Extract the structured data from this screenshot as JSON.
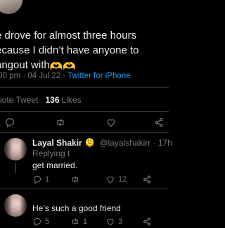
{
  "tweet": {
    "text": "e drove for almost three hours\necause I didn’t have anyone to\nangout with",
    "emoji": "🫶🫶",
    "time_date": ":00 pm · 04 Jul 22 · ",
    "source": "Twitter for iPhone",
    "quote_label": "uote Tweet",
    "likes_count": "136",
    "likes_label": "Likes"
  },
  "replies": [
    {
      "name": "Layal Shakir",
      "verified_emoji": "🫠",
      "handle": "@layalshakirr · 17h",
      "replying_to": "Replying t",
      "text": "get married.",
      "reply_count": "1",
      "retweet_count": "",
      "like_count": "12"
    },
    {
      "text": "He’s such a good friend",
      "reply_count": "5",
      "retweet_count": "1",
      "like_count": "3"
    }
  ],
  "colors": {
    "background": "#000000",
    "text": "#e7e9ea",
    "muted": "#71767b",
    "accent": "#1d9bf0",
    "divider": "#2f3336"
  },
  "icons": [
    "reply-icon",
    "retweet-icon",
    "like-icon",
    "share-icon"
  ]
}
